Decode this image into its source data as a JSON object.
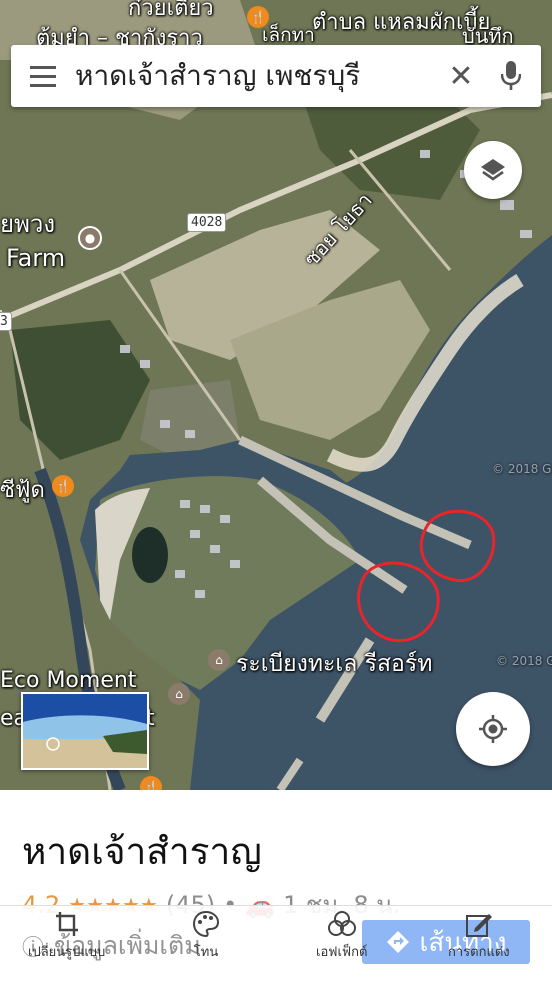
{
  "search": {
    "query": "หาดเจ้าสำราญ เพชรบุรี"
  },
  "map_labels": {
    "top_left_a": "ก๋วยเตี๋ยว",
    "top_left_b": "ต้มยำ – ชากังราว",
    "top_mid": "เล็กทา",
    "top_right": "ตำบล แหลมผักเบี้ย",
    "top_right2": "บันทึก",
    "farm_a": "ยพวง",
    "farm_b": "Farm",
    "road_number": "4028",
    "road_side": "3",
    "soi": "ซอย โยธา",
    "food_place": "ซีฟู้ด",
    "resort": "ระเบียงทะเล รีสอร์ท",
    "eco_a": "Eco Moment",
    "eco_b": "ea",
    "eco_c": "t",
    "copyright1": "© 2018 G",
    "copyright2": "© 2018 Go"
  },
  "place": {
    "title": "หาดเจ้าสำราญ",
    "rating": "4.2",
    "stars": "★★★★★",
    "reviews": "(45)",
    "separator": "•",
    "drive_time": "1 ชม. 8 น."
  },
  "toolbar": {
    "more_info": "ข้อมูลเพิ่มเติม",
    "directions": "เส้นทาง",
    "items": [
      {
        "label": "เปลี่ยนรูปแบบ",
        "icon": "crop-rotate-icon"
      },
      {
        "label": "โทน",
        "icon": "palette-icon"
      },
      {
        "label": "เอฟเฟ็กต์",
        "icon": "effects-icon"
      },
      {
        "label": "การตกแต่ง",
        "icon": "edit-icon"
      }
    ]
  },
  "colors": {
    "sea": "#3d5366",
    "land": "#6f7a55",
    "circle_annotation": "#e8252a",
    "directions_button": "#8fb6f5",
    "rating_orange": "#e37400"
  }
}
